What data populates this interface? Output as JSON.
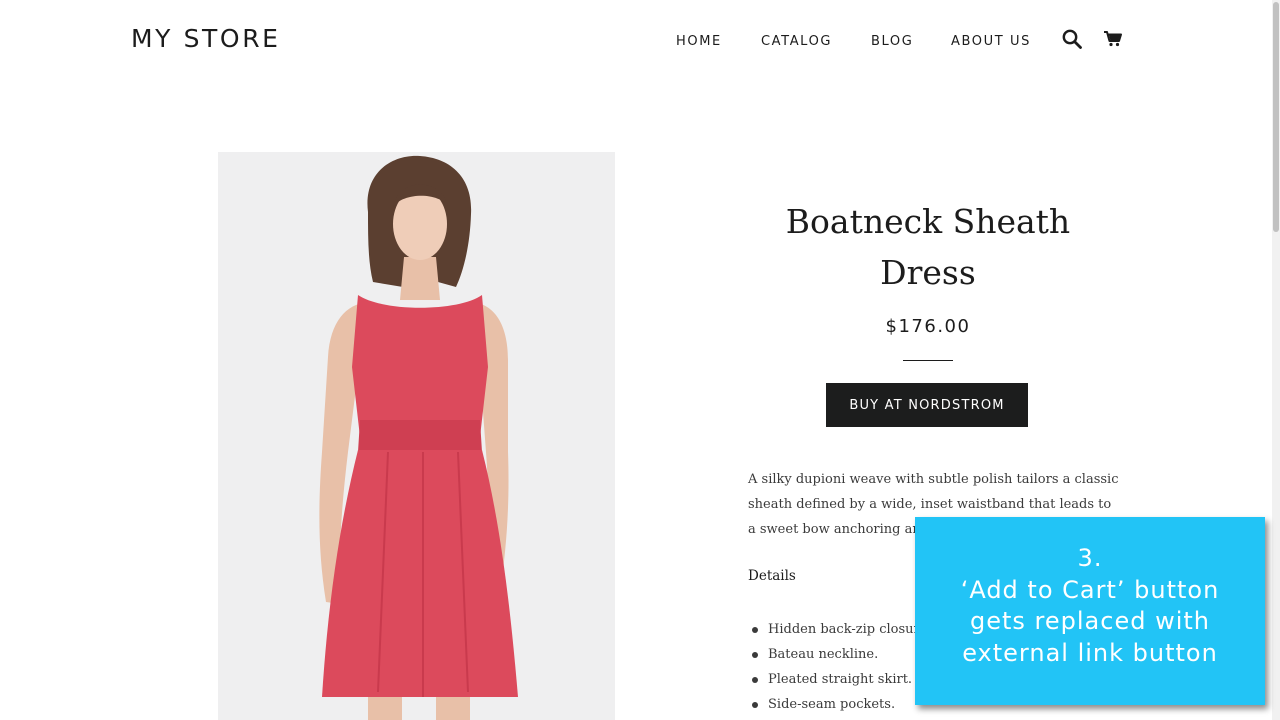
{
  "header": {
    "logo": "MY STORE",
    "nav": [
      "HOME",
      "CATALOG",
      "BLOG",
      "ABOUT US"
    ],
    "icons": [
      "search-icon",
      "cart-icon"
    ]
  },
  "product": {
    "title_line1": "Boatneck Sheath",
    "title_line2": "Dress",
    "price": "$176.00",
    "buy_button_label": "BUY AT NORDSTROM",
    "description": "A silky dupioni weave with subtle polish tailors a classic sheath defined by a wide, inset waistband that leads to a sweet bow anchoring an open back.",
    "details_heading": "Details",
    "details": [
      "Hidden back-zip closure.",
      "Bateau neckline.",
      "Pleated straight skirt.",
      "Side-seam pockets."
    ],
    "dress_color": "#dc4a5c"
  },
  "callout": {
    "line1": "3.",
    "line2": "‘Add to Cart’ button",
    "line3": "gets replaced with",
    "line4": "external link button",
    "background": "#22c4f6"
  }
}
